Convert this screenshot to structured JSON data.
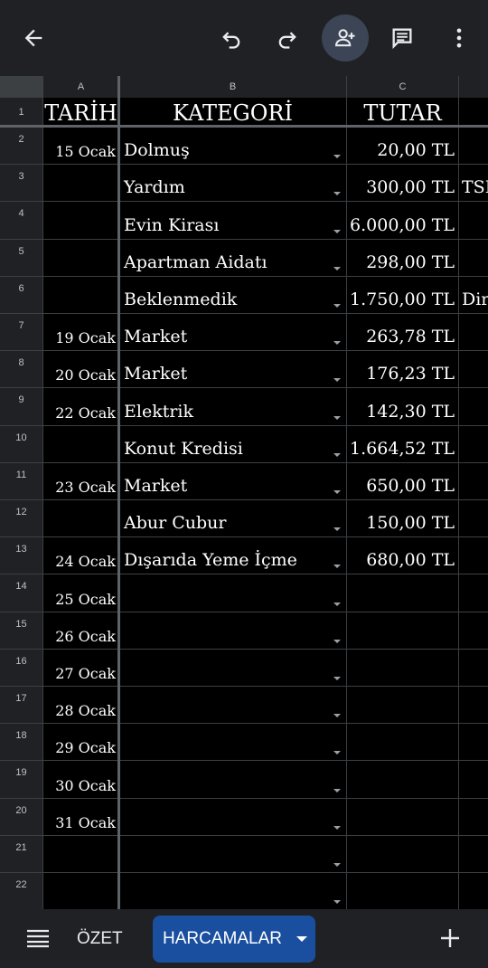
{
  "toolbar": {
    "back_icon": "arrow-back-icon",
    "undo_icon": "undo-icon",
    "redo_icon": "redo-icon",
    "share_icon": "add-person-icon",
    "comment_icon": "comment-icon",
    "more_icon": "more-vert-icon"
  },
  "columns": [
    "A",
    "B",
    "C"
  ],
  "header_row": {
    "num": "1",
    "a": "TARİH",
    "b": "KATEGORİ",
    "c": "TUTAR"
  },
  "rows": [
    {
      "num": "2",
      "a": "15 Ocak",
      "b": "Dolmuş",
      "c": "20,00 TL",
      "d": ""
    },
    {
      "num": "3",
      "a": "",
      "b": "Yardım",
      "c": "300,00 TL",
      "d": "TSK"
    },
    {
      "num": "4",
      "a": "",
      "b": "Evin Kirası",
      "c": "6.000,00 TL",
      "d": ""
    },
    {
      "num": "5",
      "a": "",
      "b": "Apartman Aidatı",
      "c": "298,00 TL",
      "d": ""
    },
    {
      "num": "6",
      "a": "",
      "b": "Beklenmedik",
      "c": "1.750,00 TL",
      "d": "Dir"
    },
    {
      "num": "7",
      "a": "19 Ocak",
      "b": "Market",
      "c": "263,78 TL",
      "d": ""
    },
    {
      "num": "8",
      "a": "20 Ocak",
      "b": "Market",
      "c": "176,23 TL",
      "d": ""
    },
    {
      "num": "9",
      "a": "22 Ocak",
      "b": "Elektrik",
      "c": "142,30 TL",
      "d": ""
    },
    {
      "num": "10",
      "a": "",
      "b": "Konut Kredisi",
      "c": "1.664,52 TL",
      "d": ""
    },
    {
      "num": "11",
      "a": "23 Ocak",
      "b": "Market",
      "c": "650,00 TL",
      "d": ""
    },
    {
      "num": "12",
      "a": "",
      "b": "Abur Cubur",
      "c": "150,00 TL",
      "d": ""
    },
    {
      "num": "13",
      "a": "24 Ocak",
      "b": "Dışarıda Yeme İçme",
      "c": "680,00 TL",
      "d": ""
    },
    {
      "num": "14",
      "a": "25 Ocak",
      "b": "",
      "c": "",
      "d": ""
    },
    {
      "num": "15",
      "a": "26 Ocak",
      "b": "",
      "c": "",
      "d": ""
    },
    {
      "num": "16",
      "a": "27 Ocak",
      "b": "",
      "c": "",
      "d": ""
    },
    {
      "num": "17",
      "a": "28 Ocak",
      "b": "",
      "c": "",
      "d": ""
    },
    {
      "num": "18",
      "a": "29 Ocak",
      "b": "",
      "c": "",
      "d": ""
    },
    {
      "num": "19",
      "a": "30 Ocak",
      "b": "",
      "c": "",
      "d": ""
    },
    {
      "num": "20",
      "a": "31 Ocak",
      "b": "",
      "c": "",
      "d": ""
    },
    {
      "num": "21",
      "a": "",
      "b": "",
      "c": "",
      "d": ""
    },
    {
      "num": "22",
      "a": "",
      "b": "",
      "c": "",
      "d": ""
    }
  ],
  "bottom": {
    "menu_icon": "sheet-list-icon",
    "tabs": [
      {
        "label": "ÖZET",
        "active": false
      },
      {
        "label": "HARCAMALAR",
        "active": true
      }
    ],
    "add_icon": "add-sheet-icon"
  }
}
